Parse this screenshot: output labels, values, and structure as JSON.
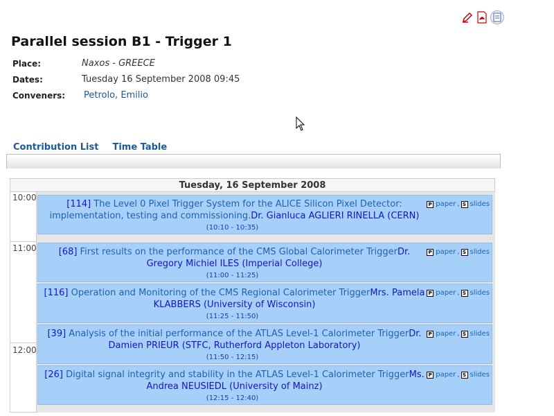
{
  "toolbar": {
    "icons": [
      "edit-icon",
      "pdf-icon",
      "calendar-export-icon"
    ]
  },
  "page_title": "Parallel session B1 - Trigger 1",
  "meta": {
    "place_label": "Place:",
    "place_value": "Naxos - GREECE",
    "dates_label": "Dates:",
    "dates_value": "Tuesday 16 September 2008 09:45",
    "conveners_label": "Conveners:",
    "conveners_value": "Petrolo, Emilio"
  },
  "tabs": {
    "contribution_list": "Contribution List",
    "time_table": "Time Table"
  },
  "timetable": {
    "day_header": "Tuesday, 16 September 2008",
    "hours": [
      "10:00",
      "11:00",
      "12:00"
    ],
    "paper_label": "paper",
    "slides_label": "slides",
    "events": [
      {
        "code": "[114]",
        "title": " The Level 0 Pixel Trigger System for the ALICE Silicon Pixel Detector: implementation, testing and commissioning.",
        "speaker": "Dr. Gianluca AGLIERI RINELLA (CERN)",
        "time": "(10:10 - 10:35)"
      },
      {
        "code": "[68]",
        "title": " First results on the performance of the CMS Global Calorimeter Trigger",
        "speaker": "Dr. Gregory Michiel ILES (Imperial College)",
        "time": "(11:00 - 11:25)"
      },
      {
        "code": "[116]",
        "title": " Operation and Monitoring of the CMS Regional Calorimeter Trigger",
        "speaker": "Mrs. Pamela KLABBERS (University of Wisconsin)",
        "time": "(11:25 - 11:50)"
      },
      {
        "code": "[39]",
        "title": " Analysis of the initial performance of the ATLAS Level-1 Calorimeter Trigger",
        "speaker": "Dr. Damien PRIEUR (STFC, Rutherford Appleton Laboratory)",
        "time": "(11:50 - 12:15)"
      },
      {
        "code": "[26]",
        "title": " Digital signal integrity and stability in the ATLAS Level-1 Calorimeter Trigger",
        "speaker": "Ms. Andrea NEUSIEDL (University of Mainz)",
        "time": "(12:15 - 12:40)"
      }
    ]
  },
  "colors": {
    "event_bg": "#a6d0fa",
    "link": "#1a5a96",
    "code": "#1414c8"
  }
}
